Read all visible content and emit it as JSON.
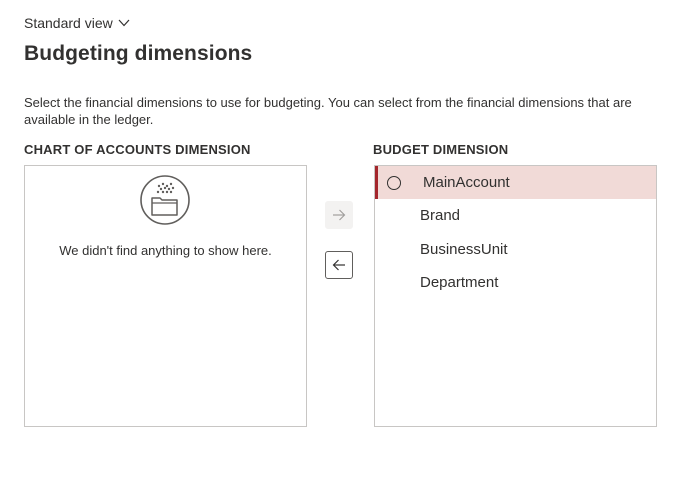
{
  "header": {
    "view_label": "Standard view",
    "title": "Budgeting dimensions"
  },
  "description": "Select the financial dimensions to use for budgeting. You can select from the financial dimensions that are available in the ledger.",
  "chart_of_accounts": {
    "header": "CHART OF ACCOUNTS DIMENSION",
    "empty_message": "We didn't find anything to show here.",
    "empty_icon": "empty-folder-icon"
  },
  "controls": {
    "add_icon": "arrow-right-icon",
    "remove_icon": "arrow-left-icon"
  },
  "budget_dimension": {
    "header": "BUDGET DIMENSION",
    "items": [
      {
        "label": "MainAccount",
        "selected": true
      },
      {
        "label": "Brand",
        "selected": false
      },
      {
        "label": "BusinessUnit",
        "selected": false
      },
      {
        "label": "Department",
        "selected": false
      }
    ]
  },
  "colors": {
    "selected_background": "#f1dad7",
    "selected_accent": "#a4262c",
    "border": "#c8c6c4"
  }
}
